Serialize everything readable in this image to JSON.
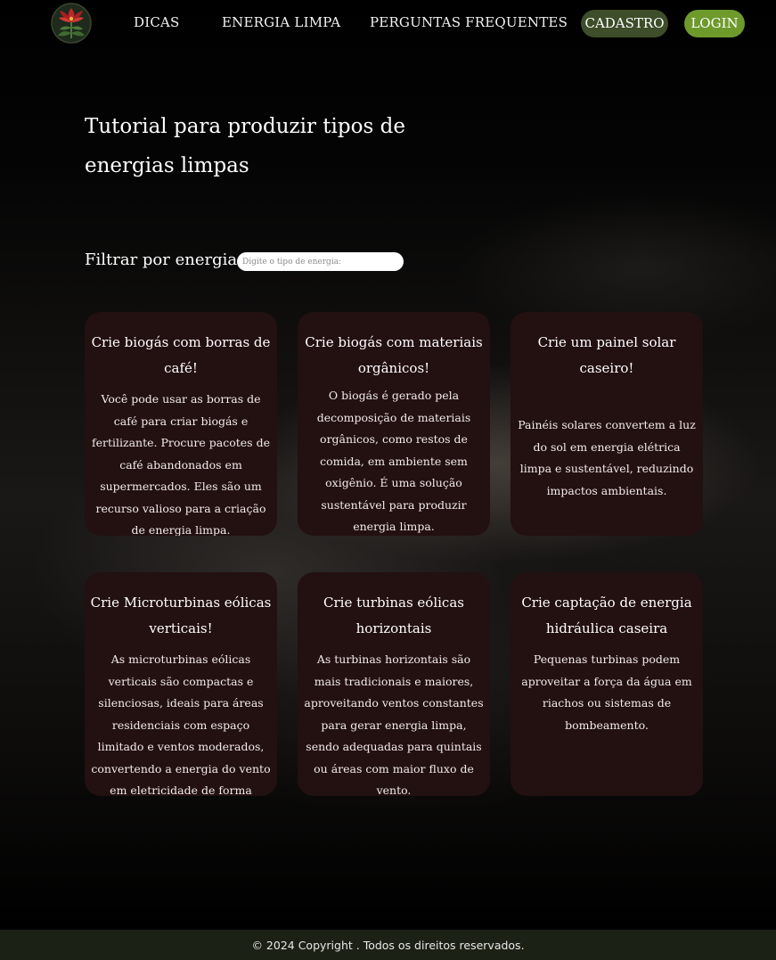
{
  "colors": {
    "card_bg": "#231011",
    "cadastro_bg": "#3e4d2a",
    "login_bg": "#6e9a2c",
    "footer_bg": "#1c2115"
  },
  "header": {
    "logo_icon": "red-flower-logo-icon",
    "nav": [
      {
        "label": "DICAS"
      },
      {
        "label": "ENERGIA LIMPA"
      },
      {
        "label": "PERGUNTAS FREQUENTES"
      }
    ],
    "cadastro_label": "CADASTRO",
    "login_label": "LOGIN"
  },
  "main": {
    "title": "Tutorial para produzir tipos de energias limpas",
    "filter_label": "Filtrar por energia:",
    "filter_placeholder": "Digite o tipo de energia:",
    "filter_value": "",
    "cards": [
      {
        "title": "Crie biogás com borras de café!",
        "text": "Você pode usar as borras de café para criar biogás e fertilizante. Procure pacotes de café abandonados em supermercados. Eles são um recurso valioso para a criação de energia limpa."
      },
      {
        "title": "Crie biogás com materiais orgânicos!",
        "text": "O biogás é gerado pela decomposição de materiais orgânicos, como restos de comida, em ambiente sem oxigênio. É uma solução sustentável para produzir energia limpa."
      },
      {
        "title": "Crie um painel solar caseiro!",
        "text": "Painéis solares convertem a luz do sol em energia elétrica limpa e sustentável, reduzindo impactos ambientais."
      },
      {
        "title": "Crie Microturbinas eólicas verticais!",
        "text": "As microturbinas eólicas verticais são compactas e silenciosas, ideais para áreas residenciais com espaço limitado e ventos moderados, convertendo a energia do vento em eletricidade de forma eficiente."
      },
      {
        "title": "Crie turbinas eólicas horizontais",
        "text": "As turbinas horizontais são mais tradicionais e maiores, aproveitando ventos constantes para gerar energia limpa, sendo adequadas para quintais ou áreas com maior fluxo de vento."
      },
      {
        "title": "Crie captação de energia hidráulica caseira",
        "text": "Pequenas turbinas podem aproveitar a força da água em riachos ou sistemas de bombeamento."
      }
    ]
  },
  "footer": {
    "text": "© 2024 Copyright . Todos os direitos reservados."
  }
}
